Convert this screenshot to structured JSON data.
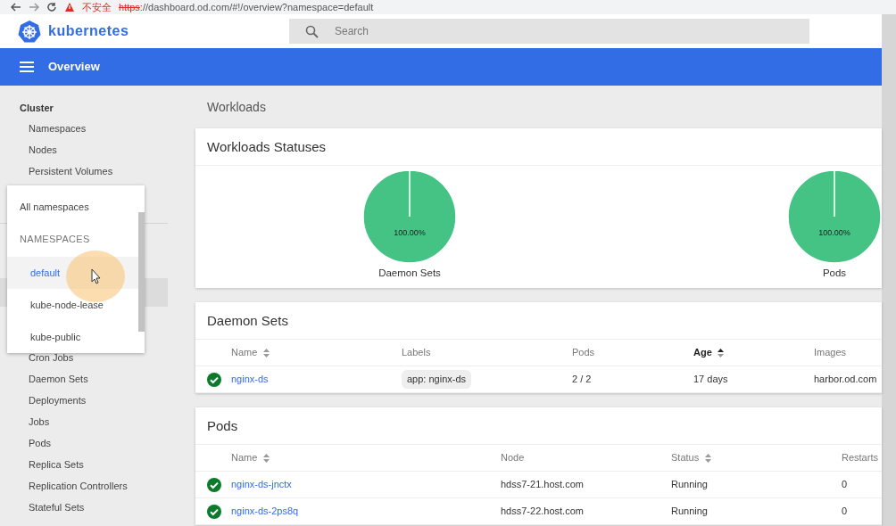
{
  "browser": {
    "warning": "不安全",
    "scheme": "https",
    "address": "://dashboard.od.com/#!/overview?namespace=default"
  },
  "header": {
    "brand": "kubernetes",
    "search": {
      "placeholder": "Search"
    }
  },
  "toolbar": {
    "title": "Overview"
  },
  "sidebar": {
    "cluster": {
      "heading": "Cluster",
      "items": [
        "Namespaces",
        "Nodes",
        "Persistent Volumes"
      ]
    },
    "workload_items": [
      "Cron Jobs",
      "Daemon Sets",
      "Deployments",
      "Jobs",
      "Pods",
      "Replica Sets",
      "Replication Controllers",
      "Stateful Sets"
    ]
  },
  "namespace_menu": {
    "all": "All namespaces",
    "heading": "NAMESPACES",
    "items": [
      {
        "label": "default",
        "selected": true
      },
      {
        "label": "kube-node-lease",
        "selected": false
      },
      {
        "label": "kube-public",
        "selected": false
      }
    ]
  },
  "content": {
    "section_title": "Workloads",
    "statuses": {
      "title": "Workloads Statuses",
      "charts": [
        {
          "chart_data": {
            "type": "pie",
            "title": "Daemon Sets",
            "values": [
              100
            ],
            "value_labels": [
              "100.00%"
            ]
          }
        },
        {
          "chart_data": {
            "type": "pie",
            "title": "Pods",
            "values": [
              100
            ],
            "value_labels": [
              "100.00%"
            ]
          }
        }
      ]
    },
    "daemon_sets": {
      "title": "Daemon Sets",
      "columns": [
        {
          "label": "Name",
          "sortable": true,
          "sorted": false
        },
        {
          "label": "Labels",
          "sortable": false,
          "sorted": false
        },
        {
          "label": "Pods",
          "sortable": false,
          "sorted": false
        },
        {
          "label": "Age",
          "sortable": true,
          "sorted": true
        },
        {
          "label": "Images",
          "sortable": false,
          "sorted": false
        }
      ],
      "rows": [
        {
          "healthy": true,
          "cells": [
            "nginx-ds",
            "app: nginx-ds",
            "2 / 2",
            "17 days",
            "harbor.od.com"
          ]
        }
      ]
    },
    "pods": {
      "title": "Pods",
      "columns": [
        {
          "label": "Name",
          "sortable": true,
          "sorted": false
        },
        {
          "label": "Node",
          "sortable": false,
          "sorted": false
        },
        {
          "label": "Status",
          "sortable": true,
          "sorted": false
        },
        {
          "label": "Restarts",
          "sortable": false,
          "sorted": false
        }
      ],
      "rows": [
        {
          "healthy": true,
          "cells": [
            "nginx-ds-jnctx",
            "hdss7-21.host.com",
            "Running",
            "0"
          ]
        },
        {
          "healthy": true,
          "cells": [
            "nginx-ds-2ps8q",
            "hdss7-22.host.com",
            "Running",
            "0"
          ]
        }
      ]
    }
  }
}
